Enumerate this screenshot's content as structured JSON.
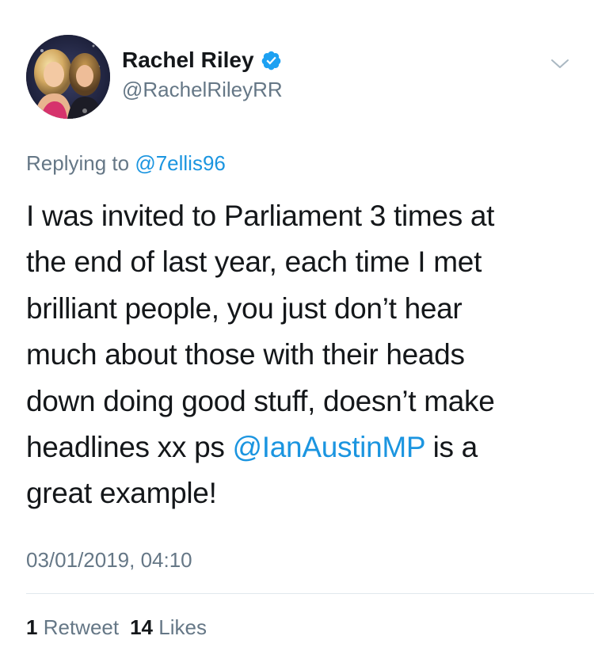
{
  "author": {
    "display_name": "Rachel Riley",
    "handle": "@RachelRileyRR",
    "verified": true,
    "avatar_icon": "profile-photo"
  },
  "reply": {
    "prefix": "Replying to",
    "to_handle": "@7ellis96"
  },
  "body": {
    "line1": "I was invited to Parliament 3 times at",
    "line2": "the end of last year, each time I met",
    "line3": "brilliant people, you just don’t hear",
    "line4": "much about those with their heads",
    "line5": "down doing good stuff, doesn’t make",
    "line6_before": "headlines xx ps ",
    "line6_mention": "@IanAustinMP",
    "line6_after": " is a",
    "line7": "great example!"
  },
  "timestamp": "03/01/2019, 04:10",
  "stats": {
    "retweets_count": "1",
    "retweets_label": "Retweet",
    "likes_count": "14",
    "likes_label": "Likes"
  },
  "colors": {
    "link": "#1b95e0",
    "secondary_text": "#657786",
    "primary_text": "#14171a",
    "verified_badge": "#1da1f2",
    "divider": "#e1e8ed"
  },
  "icons": {
    "verified": "verified-badge-icon",
    "menu": "chevron-down-icon"
  }
}
